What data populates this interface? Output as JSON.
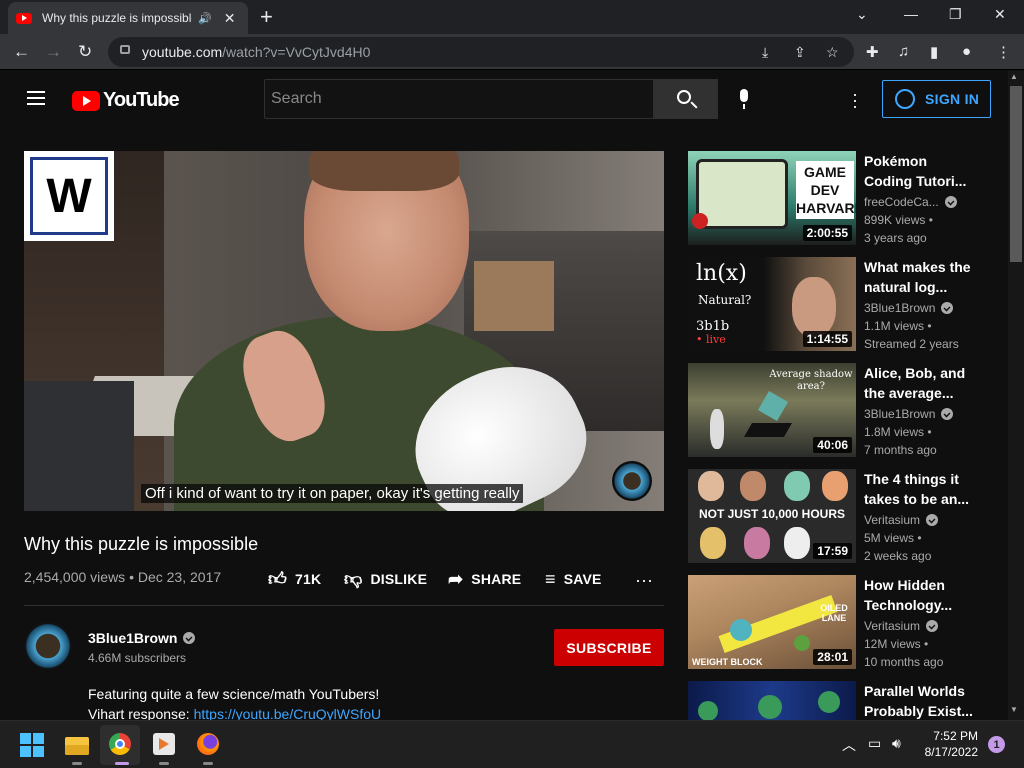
{
  "browser": {
    "tab_title": "Why this puzzle is impossible",
    "url_host": "youtube.com",
    "url_path": "/watch?v=VvCytJvd4H0"
  },
  "header": {
    "logo_text": "YouTube",
    "search_placeholder": "Search",
    "sign_in": "SIGN IN"
  },
  "player": {
    "caption": "Off i kind of want to try it on paper, okay it's getting really",
    "watermark_letter": "W"
  },
  "video": {
    "title": "Why this puzzle is impossible",
    "meta": "2,454,000 views • Dec 23, 2017",
    "likes": "71K",
    "dislike": "DISLIKE",
    "share": "SHARE",
    "save": "SAVE"
  },
  "channel": {
    "name": "3Blue1Brown",
    "subscribers": "4.66M subscribers",
    "subscribe": "SUBSCRIBE"
  },
  "description": {
    "line1": "Featuring quite a few science/math YouTubers!",
    "line2_prefix": "Vihart response: ",
    "line2_link": "https://youtu.be/CruQylWSfoU"
  },
  "sidebar": {
    "items": [
      {
        "title": "Pokémon Coding Tutori...",
        "channel": "freeCodeCa...",
        "views": "899K views •",
        "age": "3 years ago",
        "duration": "2:00:55",
        "thumb_text": "GAME DEV HARVARD"
      },
      {
        "title": "What makes the natural log...",
        "channel": "3Blue1Brown",
        "views": "1.1M views •",
        "age": "Streamed 2 years",
        "duration": "1:14:55",
        "thumb_text": "ln(x)",
        "thumb_sub": "Natural?",
        "thumb_brand": "3b1b",
        "thumb_live": "• live"
      },
      {
        "title": "Alice, Bob, and the average...",
        "channel": "3Blue1Brown",
        "views": "1.8M views •",
        "age": "7 months ago",
        "duration": "40:06",
        "thumb_text": "Average shadow area?"
      },
      {
        "title": "The 4 things it takes to be an...",
        "channel": "Veritasium",
        "views": "5M views •",
        "age": "2 weeks ago",
        "duration": "17:59",
        "thumb_text": "NOT JUST 10,000 HOURS"
      },
      {
        "title": "How Hidden Technology...",
        "channel": "Veritasium",
        "views": "12M views •",
        "age": "10 months ago",
        "duration": "28:01",
        "thumb_text": "OILED LANE",
        "thumb_sub": "WEIGHT BLOCK"
      },
      {
        "title": "Parallel Worlds Probably Exist..."
      }
    ]
  },
  "taskbar": {
    "time": "7:52 PM",
    "date": "8/17/2022",
    "notifications": "1"
  },
  "icons": {
    "brand_red": "#ff0000",
    "link_blue": "#3ea6ff",
    "subscribe_red": "#cc0000"
  }
}
